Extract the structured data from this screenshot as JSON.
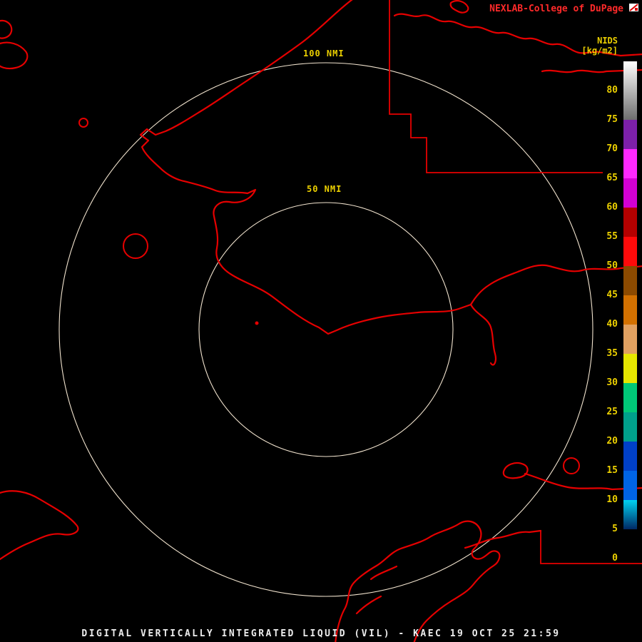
{
  "header": {
    "brand": "NEXLAB-College of DuPage"
  },
  "colorbar": {
    "title": "NIDS",
    "units": "[kg/m2]",
    "tick_labels": [
      "80",
      "75",
      "70",
      "65",
      "60",
      "55",
      "50",
      "45",
      "40",
      "35",
      "30",
      "25",
      "20",
      "15",
      "10",
      "5",
      "0"
    ],
    "segments": [
      {
        "range": "75-85",
        "gradient": [
          "#ffffff",
          "#6e6e6e"
        ],
        "h": 82
      },
      {
        "range": "70-75",
        "color": "#7d20aa",
        "h": 41
      },
      {
        "range": "65-70",
        "color": "#ff28ff",
        "h": 41
      },
      {
        "range": "60-65",
        "color": "#d400d4",
        "h": 41
      },
      {
        "range": "55-60",
        "color": "#b40000",
        "h": 41
      },
      {
        "range": "50-55",
        "color": "#ff0a0a",
        "h": 41
      },
      {
        "range": "45-50",
        "color": "#8c4a00",
        "h": 41
      },
      {
        "range": "40-45",
        "color": "#d27000",
        "h": 41
      },
      {
        "range": "35-40",
        "color": "#e0a060",
        "h": 41
      },
      {
        "range": "30-35",
        "color": "#e6e600",
        "h": 41
      },
      {
        "range": "25-30",
        "color": "#00c878",
        "h": 41
      },
      {
        "range": "20-25",
        "color": "#00a08c",
        "h": 41
      },
      {
        "range": "15-20",
        "color": "#0040c8",
        "h": 41
      },
      {
        "range": "10-15",
        "color": "#0064e6",
        "h": 41
      },
      {
        "range": "5-10",
        "gradient": [
          "#00d2f0",
          "#002864"
        ],
        "h": 41
      },
      {
        "range": "0-5",
        "color": "#000000",
        "h": 41
      }
    ]
  },
  "rings": {
    "outer_label": "100 NMI",
    "inner_label": "50 NMI"
  },
  "footer": {
    "title": "DIGITAL VERTICALLY INTEGRATED LIQUID (VIL) - KAEC 19 OCT 25 21:59"
  },
  "colors": {
    "map_outline": "#e60000",
    "ring": "#f2e4cf",
    "label_yellow": "#ecd000",
    "brand_red": "#ff2a2a",
    "footer_text": "#ededed"
  }
}
